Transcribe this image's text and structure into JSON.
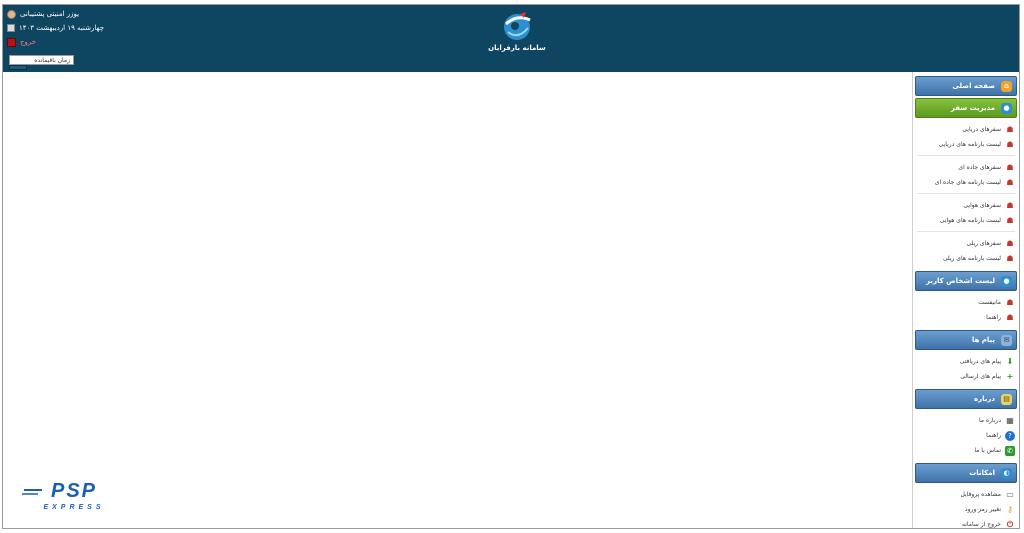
{
  "header": {
    "user_label": "یوزر امنیتی پشتیبانی",
    "date_label": "چهارشنبه ۱۹ اردیبهشت ۱۴۰۳",
    "logout_label": "خروج",
    "session_label": "زمان باقیمانده",
    "app_title": "سامانه بارفرایان"
  },
  "sidebar": {
    "home": {
      "label": "صفحه اصلی",
      "icon": "home-icon"
    },
    "travel_management": {
      "label": "مدیریت سفر",
      "groups": [
        [
          "سفرهای دریایی",
          "لیست بارنامه های دریایی"
        ],
        [
          "سفرهای جاده ای",
          "لیست بارنامه های جاده ای"
        ],
        [
          "سفرهای هوایی",
          "لیست بارنامه های هوایی"
        ],
        [
          "سفرهای ریلی",
          "لیست بارنامه های ریلی"
        ]
      ]
    },
    "contacts": {
      "label": "لیست اشخاص کاربر",
      "items": [
        "مانیفست",
        "راهنما"
      ]
    },
    "messages": {
      "label": "پیام ها",
      "items": [
        "پیام های دریافتی",
        "پیام های ارسالی"
      ]
    },
    "about": {
      "label": "درباره",
      "items": [
        "درباره ما",
        "راهنما",
        "تماس با ما"
      ]
    },
    "tools": {
      "label": "امکانات",
      "items": [
        "مشاهده پروفایل",
        "تغییر رمز ورود",
        "خروج از سامانه"
      ]
    }
  },
  "brand": {
    "name": "PSP",
    "tagline": "EXPRESS"
  },
  "colors": {
    "header_bg": "#0e4560",
    "section_blue": "#3f72a8",
    "section_green": "#5c9a1e",
    "brand_blue": "#1a5fb4"
  }
}
